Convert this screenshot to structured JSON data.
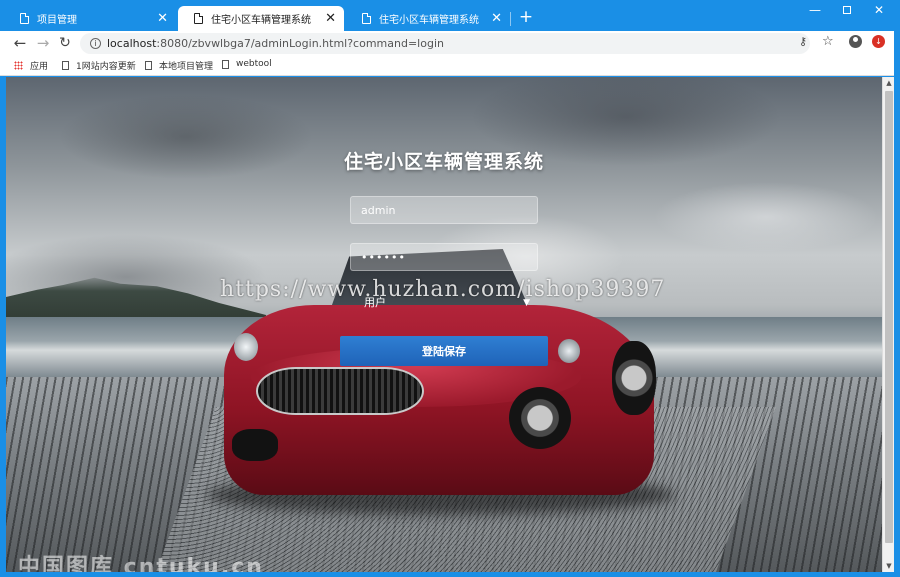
{
  "browser": {
    "tabs": [
      {
        "title": "项目管理",
        "active": false
      },
      {
        "title": "住宅小区车辆管理系统",
        "active": true
      },
      {
        "title": "住宅小区车辆管理系统",
        "active": false
      }
    ],
    "new_tab_label": "+",
    "window_controls": {
      "minimize": "—",
      "close": "✕"
    },
    "address": {
      "host": "localhost",
      "rest": ":8080/zbvwlbga7/adminLogin.html?command=login"
    },
    "bookmarks": [
      {
        "label": "应用",
        "icon": "apps-grid-icon"
      },
      {
        "label": "1网站内容更新",
        "icon": "page-icon"
      },
      {
        "label": "本地项目管理",
        "icon": "page-icon"
      },
      {
        "label": "webtool",
        "icon": "page-icon"
      }
    ]
  },
  "login": {
    "title": "住宅小区车辆管理系统",
    "username_value": "admin",
    "password_value": "••••••",
    "role_value": "用户",
    "submit_label": "登陆保存"
  },
  "watermarks": {
    "url": "https://www.huzhan.com/ishop39397",
    "bottom": "中国图库 cntuku.cn"
  },
  "colors": {
    "titlebar": "#1a8fe6",
    "login_button": "#2a74cc"
  }
}
